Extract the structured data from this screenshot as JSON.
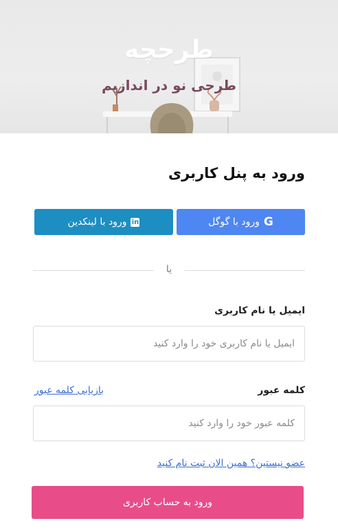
{
  "hero": {
    "logo_text": "طرحچه",
    "tagline": "طرحی نو در اندازیم"
  },
  "login": {
    "title": "ورود به پنل کاربری",
    "google_label": "ورود با گوگل",
    "linkedin_label": "ورود با لینکدین",
    "or_text": "یا",
    "username_label": "ایمیل یا نام کاربری",
    "username_placeholder": "ایمیل یا نام کاربری خود را وارد کنید",
    "password_label": "کلمه عبور",
    "password_placeholder": "کلمه عبور خود را وارد کنید",
    "forgot_link": "بازیابی کلمه عبور",
    "register_link": "عضو نیستین؟ همین الان ثبت نام کنید",
    "submit_label": "ورود به حساب کاربری"
  },
  "icons": {
    "google": "google-icon",
    "linkedin": "linkedin-icon"
  },
  "colors": {
    "google": "#4e86f2",
    "linkedin": "#1d8ec2",
    "submit": "#e84d89",
    "link": "#3b6fd1",
    "tagline": "#7a4a5e"
  }
}
